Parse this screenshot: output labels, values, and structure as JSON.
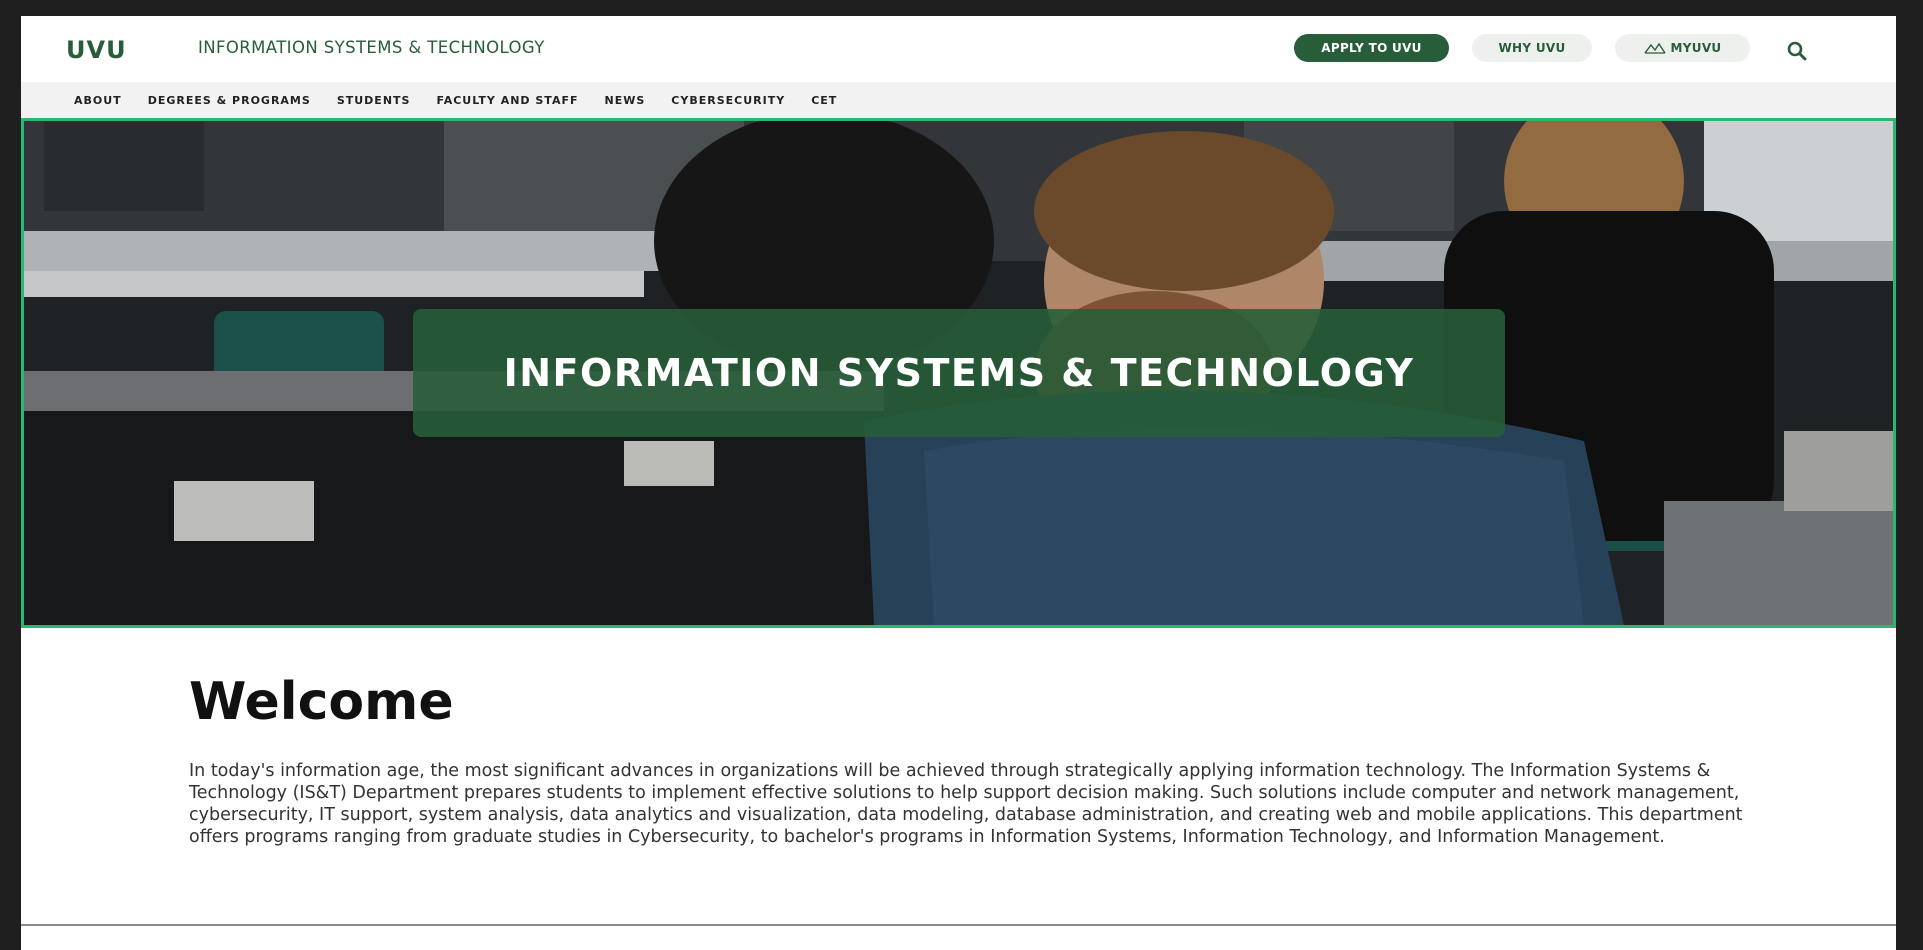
{
  "header": {
    "logo": "UVU",
    "site_title": "INFORMATION SYSTEMS & TECHNOLOGY",
    "apply_label": "APPLY TO UVU",
    "why_label": "WHY UVU",
    "myuvu_label": "MYUVU"
  },
  "nav": {
    "items": [
      "ABOUT",
      "DEGREES & PROGRAMS",
      "STUDENTS",
      "FACULTY AND STAFF",
      "NEWS",
      "CYBERSECURITY",
      "CET"
    ]
  },
  "hero": {
    "title": "INFORMATION SYSTEMS & TECHNOLOGY"
  },
  "welcome": {
    "heading": "Welcome",
    "body": "In today's information age, the most significant advances in organizations will be achieved through strategically applying information technology. The Information Systems & Technology (IS&T) Department prepares students to implement effective solutions to help support decision making. Such solutions include computer and network management, cybersecurity, IT support, system analysis, data analytics and visualization, data modeling, database administration, and creating web and mobile applications. This department offers programs ranging from graduate studies in Cybersecurity, to bachelor's programs in Information Systems, Information Technology, and Information Management."
  },
  "colors": {
    "brand_green": "#275d38",
    "hero_border": "#2bb673",
    "pill_bg": "#eef0ee",
    "nav_bg": "#f2f2f2"
  },
  "icons": {
    "search": "search-icon",
    "myuvu": "mountain-icon"
  }
}
